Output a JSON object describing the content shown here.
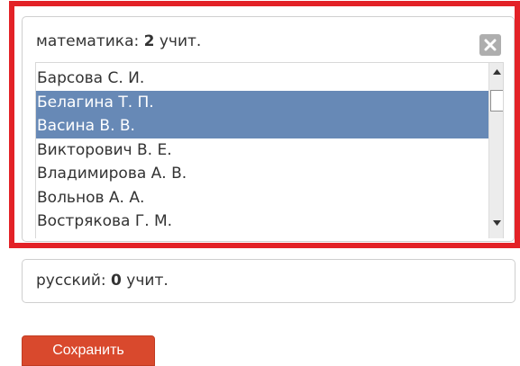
{
  "colors": {
    "highlight_frame": "#e32227",
    "selected_row": "#6789b6",
    "save_button": "#d9492d",
    "close_button": "#aeaeae"
  },
  "subjects": [
    {
      "name": "математика:",
      "count": "2",
      "unit": "учит.",
      "close_icon": "close-x-icon",
      "teachers": [
        {
          "name": "Барсова С. И.",
          "selected": false
        },
        {
          "name": "Белагина Т. П.",
          "selected": true
        },
        {
          "name": "Васина В. В.",
          "selected": true
        },
        {
          "name": "Викторович В. Е.",
          "selected": false
        },
        {
          "name": "Владимирова А. В.",
          "selected": false
        },
        {
          "name": "Вольнов А. А.",
          "selected": false
        },
        {
          "name": "Вострякова Г. М.",
          "selected": false
        }
      ]
    },
    {
      "name": "русский:",
      "count": "0",
      "unit": "учит."
    }
  ],
  "actions": {
    "save_label": "Сохранить"
  }
}
